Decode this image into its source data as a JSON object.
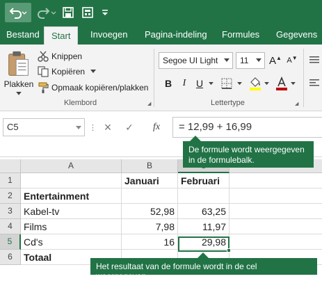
{
  "quick_access": {
    "undo_icon": "undo-icon",
    "redo_icon": "redo-icon",
    "save_icon": "save-icon",
    "form_icon": "form-icon",
    "more_icon": "customize-icon"
  },
  "tabs": [
    {
      "label": "Bestand"
    },
    {
      "label": "Start",
      "active": true
    },
    {
      "label": "Invoegen"
    },
    {
      "label": "Pagina-indeling"
    },
    {
      "label": "Formules"
    },
    {
      "label": "Gegevens"
    }
  ],
  "ribbon": {
    "clipboard": {
      "paste_label": "Plakken",
      "cut_label": "Knippen",
      "copy_label": "Kopiëren",
      "format_painter_label": "Opmaak kopiëren/plakken",
      "group_label": "Klembord"
    },
    "font": {
      "font_name": "Segoe UI Light",
      "font_size": "11",
      "group_label": "Lettertype",
      "grow_label": "A",
      "shrink_label": "A",
      "bold_label": "B",
      "italic_label": "I",
      "underline_label": "U"
    },
    "colors": {
      "accent": "#217346",
      "highlight": "#ffff00",
      "font_color": "#c00000"
    }
  },
  "formula_bar": {
    "name_box": "C5",
    "cancel_icon": "×",
    "enter_icon": "✓",
    "fx_label": "fx",
    "formula": "= 12,99 + 16,99"
  },
  "callouts": {
    "formula_bar": "De formule wordt weergegeven in de formulebalk.",
    "cell": "Het resultaat van de formule wordt in de cel weergegeven."
  },
  "sheet": {
    "columns": [
      "A",
      "B",
      "C"
    ],
    "rows": [
      {
        "num": "1",
        "a": "",
        "b": "Januari",
        "c": "Februari"
      },
      {
        "num": "2",
        "a": "Entertainment",
        "b": "",
        "c": ""
      },
      {
        "num": "3",
        "a": "Kabel-tv",
        "b": "52,98",
        "c": "63,25"
      },
      {
        "num": "4",
        "a": "Films",
        "b": "7,98",
        "c": "11,97"
      },
      {
        "num": "5",
        "a": "Cd's",
        "b": "16",
        "c": "29,98"
      },
      {
        "num": "6",
        "a": "Totaal",
        "b": "",
        "c": ""
      }
    ],
    "active_cell": "C5"
  }
}
